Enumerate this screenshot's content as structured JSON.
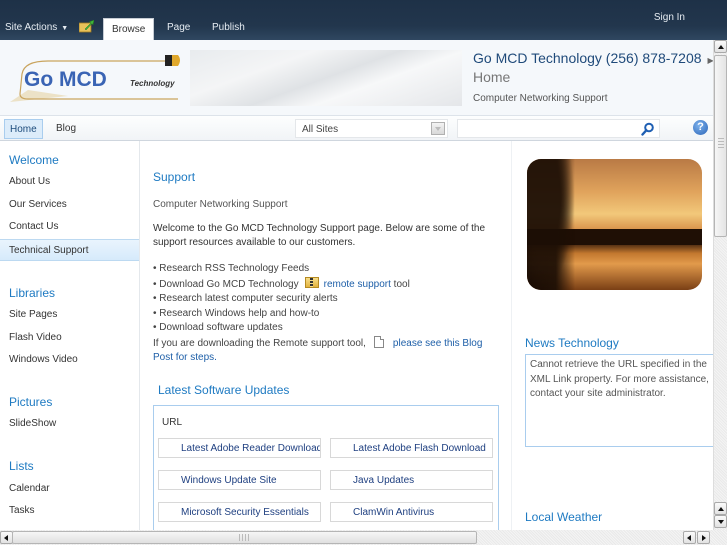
{
  "ribbon": {
    "site_actions": "Site Actions",
    "tabs": [
      {
        "label": "Browse",
        "active": true
      },
      {
        "label": "Page",
        "active": false
      },
      {
        "label": "Publish",
        "active": false
      }
    ],
    "sign_in": "Sign In"
  },
  "header": {
    "logo": {
      "main": "Go MCD",
      "sub": "Technology"
    },
    "site_title": "Go MCD Technology (256) 878-7208",
    "page_title": "Home",
    "description": "Computer Networking Support"
  },
  "topnav": {
    "links": [
      {
        "label": "Home",
        "selected": true
      },
      {
        "label": "Blog",
        "selected": false
      }
    ],
    "scope_value": "All Sites",
    "search_value": "",
    "help_label": "?"
  },
  "leftnav": {
    "sections": [
      {
        "heading": "Welcome",
        "items": [
          "About Us",
          "Our Services",
          "Contact Us",
          "Technical Support"
        ],
        "selected": "Technical Support"
      },
      {
        "heading": "Libraries",
        "items": [
          "Site Pages",
          "Flash Video",
          "Windows Video"
        ]
      },
      {
        "heading": "Pictures",
        "items": [
          "SlideShow"
        ]
      },
      {
        "heading": "Lists",
        "items": [
          "Calendar",
          "Tasks"
        ]
      }
    ]
  },
  "main": {
    "heading": "Support",
    "subtitle": "Computer Networking Support",
    "intro": "Welcome to the Go MCD Technology Support page. Below are some of the support resources available to our customers.",
    "bullets": {
      "b1": "• Research RSS Technology Feeds",
      "b2_prefix": "• Download Go MCD Technology",
      "b2_link": "remote support",
      "b2_suffix": " tool",
      "b3": "• Research latest computer security alerts",
      "b4": "• Research Windows help and how-to",
      "b5": "• Download software updates"
    },
    "remote_note": "If you are downloading the Remote support tool,",
    "remote_note_link_1": "please see this Blog",
    "remote_note_link_2": "Post for steps.",
    "updates": {
      "heading": "Latest Software Updates",
      "column_header": "URL",
      "links": [
        "Latest Adobe Reader Download",
        "Latest Adobe Flash Download",
        "Windows Update Site",
        "Java Updates",
        "Microsoft Security Essentials",
        "ClamWin Antivirus"
      ]
    }
  },
  "right": {
    "news_heading": "News Technology",
    "news_error": "Cannot retrieve the URL specified in the XML Link property. For more assistance, contact your site administrator.",
    "weather_heading": "Local Weather"
  },
  "colors": {
    "ribbon_bg": "#22364d",
    "heading_blue": "#1e7ac2",
    "link_blue": "#1e5fa8",
    "selected_bg": "#dcecfa"
  }
}
